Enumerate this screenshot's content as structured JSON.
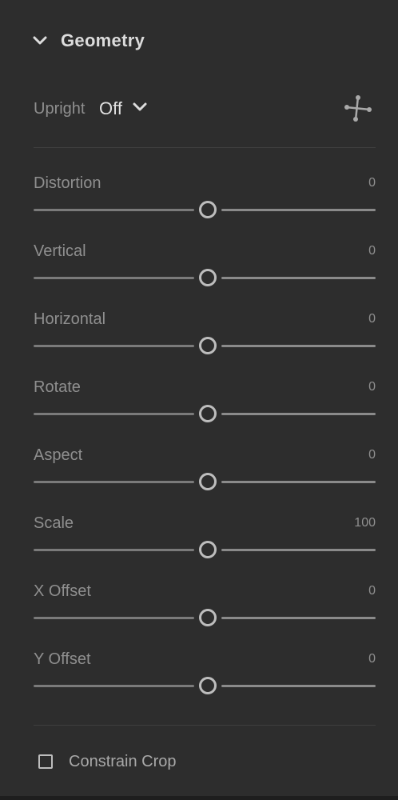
{
  "header": {
    "title": "Geometry",
    "icon": "chevron-down-icon"
  },
  "upright": {
    "label": "Upright",
    "value": "Off",
    "dropdown_icon": "chevron-down-icon",
    "guided_icon": "guided-upright-icon"
  },
  "sliders": [
    {
      "label": "Distortion",
      "value": "0",
      "position": 0.5
    },
    {
      "label": "Vertical",
      "value": "0",
      "position": 0.5
    },
    {
      "label": "Horizontal",
      "value": "0",
      "position": 0.5
    },
    {
      "label": "Rotate",
      "value": "0",
      "position": 0.5
    },
    {
      "label": "Aspect",
      "value": "0",
      "position": 0.5
    },
    {
      "label": "Scale",
      "value": "100",
      "position": 0.5
    },
    {
      "label": "X Offset",
      "value": "0",
      "position": 0.5
    },
    {
      "label": "Y Offset",
      "value": "0",
      "position": 0.5
    }
  ],
  "constrain_crop": {
    "label": "Constrain Crop",
    "checked": false
  },
  "colors": {
    "background": "#2d2d2d",
    "track": "#7a7a7a",
    "thumb": "#bdbdbd",
    "text_muted": "#8f8f8f",
    "text_bright": "#dcdcdc"
  }
}
